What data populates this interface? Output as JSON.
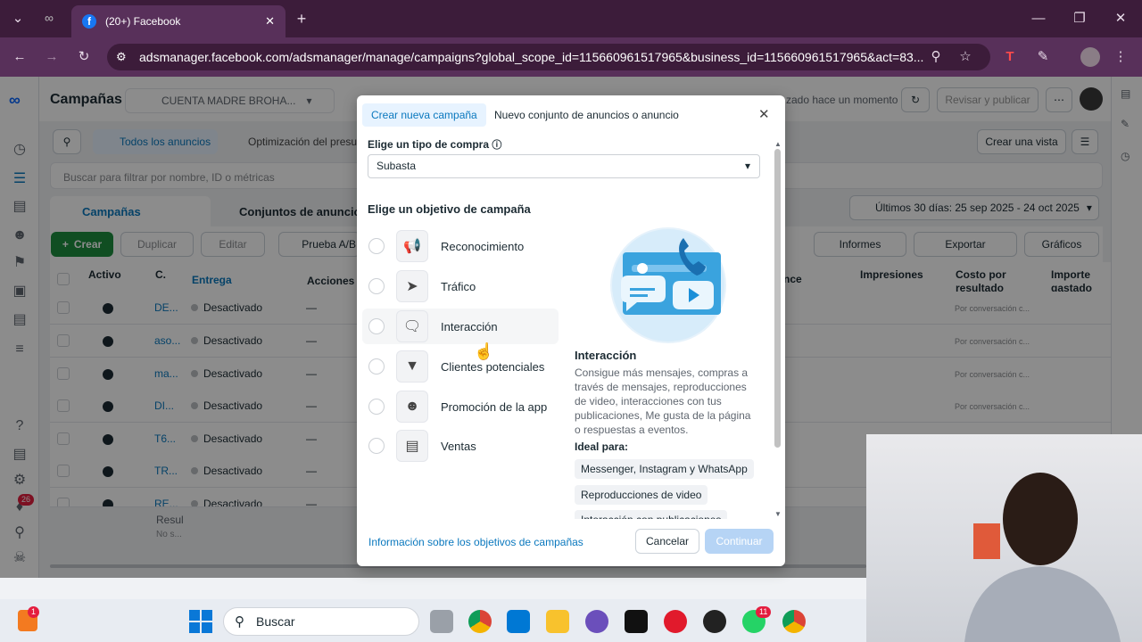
{
  "browser": {
    "tab_title": "(20+) Facebook",
    "url": "adsmanager.facebook.com/adsmanager/manage/campaigns?global_scope_id=115660961517965&business_id=115660961517965&act=83..."
  },
  "header": {
    "title": "Campañas",
    "account": "CUENTA MADRE BROHA...",
    "updated": "zado hace un momento",
    "review_button": "Revisar y publicar",
    "create_view": "Crear una vista"
  },
  "filters": {
    "all_ads": "Todos los anuncios",
    "optimization": "Optimización del presup",
    "search_placeholder": "Buscar para filtrar por nombre, ID o métricas",
    "date_range": "Últimos 30 días: 25 sep 2025 - 24 oct 2025"
  },
  "level_tabs": {
    "campaigns": "Campañas",
    "adsets": "Conjuntos de anuncios"
  },
  "toolbar": {
    "create": "Crear",
    "duplicate": "Duplicar",
    "edit": "Editar",
    "abtest": "Prueba A/B",
    "reports": "Informes",
    "export": "Exportar",
    "charts": "Gráficos"
  },
  "table": {
    "headers": {
      "active": "Activo",
      "c": "C.",
      "delivery": "Entrega",
      "actions": "Acciones",
      "nce": "nce",
      "impressions": "Impresiones",
      "cost_per_result": "Costo por resultado",
      "amount_spent": "Importe gastado"
    },
    "rows": [
      {
        "name": "DE...",
        "delivery": "Desactivado",
        "actions": "—",
        "cost": "Por conversación c..."
      },
      {
        "name": "aso...",
        "delivery": "Desactivado",
        "actions": "—",
        "cost": "Por conversación c..."
      },
      {
        "name": "ma...",
        "delivery": "Desactivado",
        "actions": "—",
        "cost": "Por conversación c..."
      },
      {
        "name": "DI...",
        "delivery": "Desactivado",
        "actions": "—",
        "cost": "Por conversación c..."
      },
      {
        "name": "T6...",
        "delivery": "Desactivado",
        "actions": "—",
        "cost": ""
      },
      {
        "name": "TR...",
        "delivery": "Desactivado",
        "actions": "—",
        "cost": ""
      },
      {
        "name": "RE...",
        "delivery": "Desactivado",
        "actions": "—",
        "cost": ""
      }
    ],
    "results_label": "Resul",
    "results_sub": "No s..."
  },
  "nav_badge": "26",
  "modal": {
    "tab_new_campaign": "Crear nueva campaña",
    "tab_new_set": "Nuevo conjunto de anuncios o anuncio",
    "purchase_type_label": "Elige un tipo de compra",
    "purchase_type_value": "Subasta",
    "objective_heading": "Elige un objetivo de campaña",
    "objectives": [
      {
        "label": "Reconocimiento",
        "icon": "megaphone-icon"
      },
      {
        "label": "Tráfico",
        "icon": "cursor-icon"
      },
      {
        "label": "Interacción",
        "icon": "chat-bubbles-icon"
      },
      {
        "label": "Clientes potenciales",
        "icon": "funnel-icon"
      },
      {
        "label": "Promoción de la app",
        "icon": "people-icon"
      },
      {
        "label": "Ventas",
        "icon": "shopping-bag-icon"
      }
    ],
    "detail_title": "Interacción",
    "detail_text": "Consigue más mensajes, compras a través de mensajes, reproducciones de video, interacciones con tus publicaciones, Me gusta de la página o respuestas a eventos.",
    "ideal_for": "Ideal para:",
    "chips": [
      "Messenger, Instagram y WhatsApp",
      "Reproducciones de video",
      "Interacción con publicaciones"
    ],
    "info_link": "Información sobre los objetivos de campañas",
    "cancel": "Cancelar",
    "continue": "Continuar"
  },
  "taskbar": {
    "search": "Buscar",
    "whatsapp_badge": "11",
    "notif_badge": "1"
  },
  "colors": {
    "accent": "#0a78be",
    "primary_green": "#1e8e3e",
    "continue_disabled": "#b6d4f5"
  }
}
